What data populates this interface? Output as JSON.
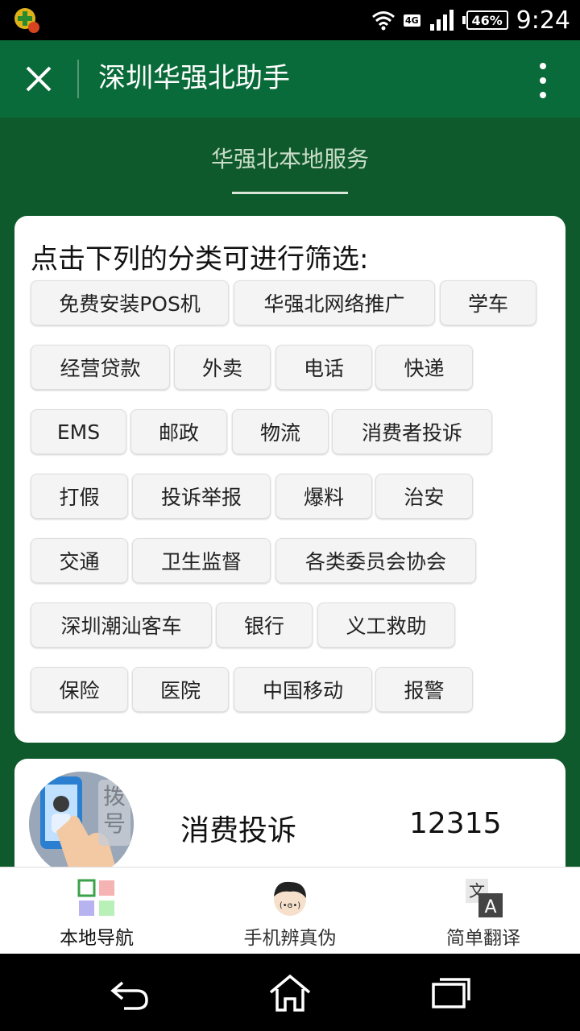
{
  "status_bar": {
    "time": "9:24",
    "battery": "46%",
    "network": "4G"
  },
  "header": {
    "title": "深圳华强北助手"
  },
  "section": {
    "title": "华强北本地服务"
  },
  "filter": {
    "title": "点击下列的分类可进行筛选:",
    "chips": [
      "免费安装POS机",
      "华强北网络推广",
      "学车",
      "经营贷款",
      "外卖",
      "电话",
      "快递",
      "EMS",
      "邮政",
      "物流",
      "消费者投诉",
      "打假",
      "投诉举报",
      "爆料",
      "治安",
      "交通",
      "卫生监督",
      "各类委员会协会",
      "深圳潮汕客车",
      "银行",
      "义工救助",
      "保险",
      "医院",
      "中国移动",
      "报警"
    ]
  },
  "list": {
    "items": [
      {
        "name": "消费投诉",
        "phone": "12315",
        "avatar_badge": "拨号"
      }
    ]
  },
  "bottom_nav": {
    "items": [
      {
        "label": "本地导航",
        "icon": "grid-icon"
      },
      {
        "label": "手机辨真伪",
        "icon": "face-icon"
      },
      {
        "label": "简单翻译",
        "icon": "translate-icon"
      }
    ]
  },
  "colors": {
    "title_bar": "#0a6b3a",
    "page_bg": "#0f5a2c",
    "chip_bg": "#f4f4f4"
  }
}
